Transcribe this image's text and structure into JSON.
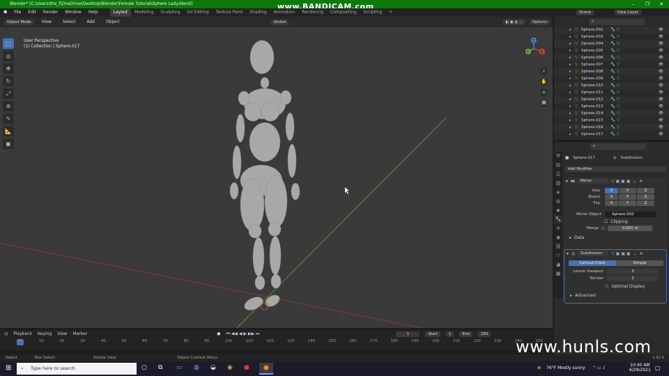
{
  "title_bar": {
    "text": "Blender* [C:\\Users\\the_f\\OneDrive\\Desktop\\Blender\\Female Tutorial\\Sphere Lady.blend]",
    "watermark": "www.BANDICAM.com",
    "minimize": "–",
    "maximize": "❐",
    "close": "✕"
  },
  "menus": [
    "File",
    "Edit",
    "Render",
    "Window",
    "Help"
  ],
  "workspaces": [
    "Layout",
    "Modeling",
    "Sculpting",
    "UV Editing",
    "Texture Paint",
    "Shading",
    "Animation",
    "Rendering",
    "Compositing",
    "Scripting"
  ],
  "scene": "Scene",
  "view_layer": "View Layer",
  "viewport_header": {
    "mode": "Object Mode",
    "menus": [
      "View",
      "Select",
      "Add",
      "Object"
    ],
    "orientation": "Global",
    "options": "Options"
  },
  "viewport": {
    "perspective": "User Perspective",
    "collection": "(1) Collection | Sphere.017",
    "gizmo": {
      "x": "X",
      "y": "Y",
      "z": "Z"
    }
  },
  "tools": [
    "select-box",
    "cursor",
    "move",
    "rotate",
    "scale",
    "transform",
    "annotate",
    "measure",
    "add-cube"
  ],
  "outliner": {
    "items": [
      "Sphere.002",
      "Sphere.003",
      "Sphere.004",
      "Sphere.005",
      "Sphere.006",
      "Sphere.007",
      "Sphere.008",
      "Sphere.009",
      "Sphere.010",
      "Sphere.011",
      "Sphere.012",
      "Sphere.013",
      "Sphere.014",
      "Sphere.015",
      "Sphere.016",
      "Sphere.017"
    ]
  },
  "properties": {
    "object": "Sphere.017",
    "modifier_breadcrumb": "Subdivision",
    "add_modifier": "Add Modifier",
    "mirror": {
      "name": "Mirror",
      "axis_label": "Axis",
      "bisect_label": "Bisect",
      "flip_label": "Flip",
      "x": "X",
      "y": "Y",
      "z": "Z",
      "mirror_object_label": "Mirror Object",
      "mirror_object": "Sphere.002",
      "clipping": "Clipping",
      "merge_label": "Merge",
      "merge_value": "0.001 m",
      "data_panel": "Data"
    },
    "subdivision": {
      "name": "Subdivision",
      "catmull": "Catmull-Clark",
      "simple": "Simple",
      "levels_label": "Levels Viewport",
      "levels": "3",
      "render_label": "Render",
      "render": "2",
      "optimal": "Optimal Display",
      "advanced": "Advanced"
    }
  },
  "timeline": {
    "menus": [
      "Playback",
      "Keying",
      "View",
      "Marker"
    ],
    "current": "1",
    "start_label": "Start",
    "start": "1",
    "end_label": "End",
    "end": "250",
    "ticks": [
      "0",
      "10",
      "20",
      "30",
      "40",
      "50",
      "60",
      "70",
      "80",
      "90",
      "100",
      "110",
      "120",
      "130",
      "140",
      "150",
      "160",
      "170",
      "180",
      "190",
      "200",
      "210",
      "220",
      "230",
      "240",
      "250"
    ]
  },
  "status": {
    "select": "Select",
    "box_select": "Box Select",
    "rotate_view": "Rotate View",
    "context_menu": "Object Context Menu",
    "version": "2.92.0"
  },
  "taskbar": {
    "search_placeholder": "Type here to search",
    "weather": "76°F  Mostly sunny",
    "time": "10:40 AM",
    "date": "6/29/2021"
  },
  "watermark_site": "www.hunls.com",
  "colors": {
    "accent": "#4772b3",
    "titlebar": "#0b7a0b",
    "grid_x": "#8b3a3a",
    "grid_y": "#6a8a2a"
  }
}
